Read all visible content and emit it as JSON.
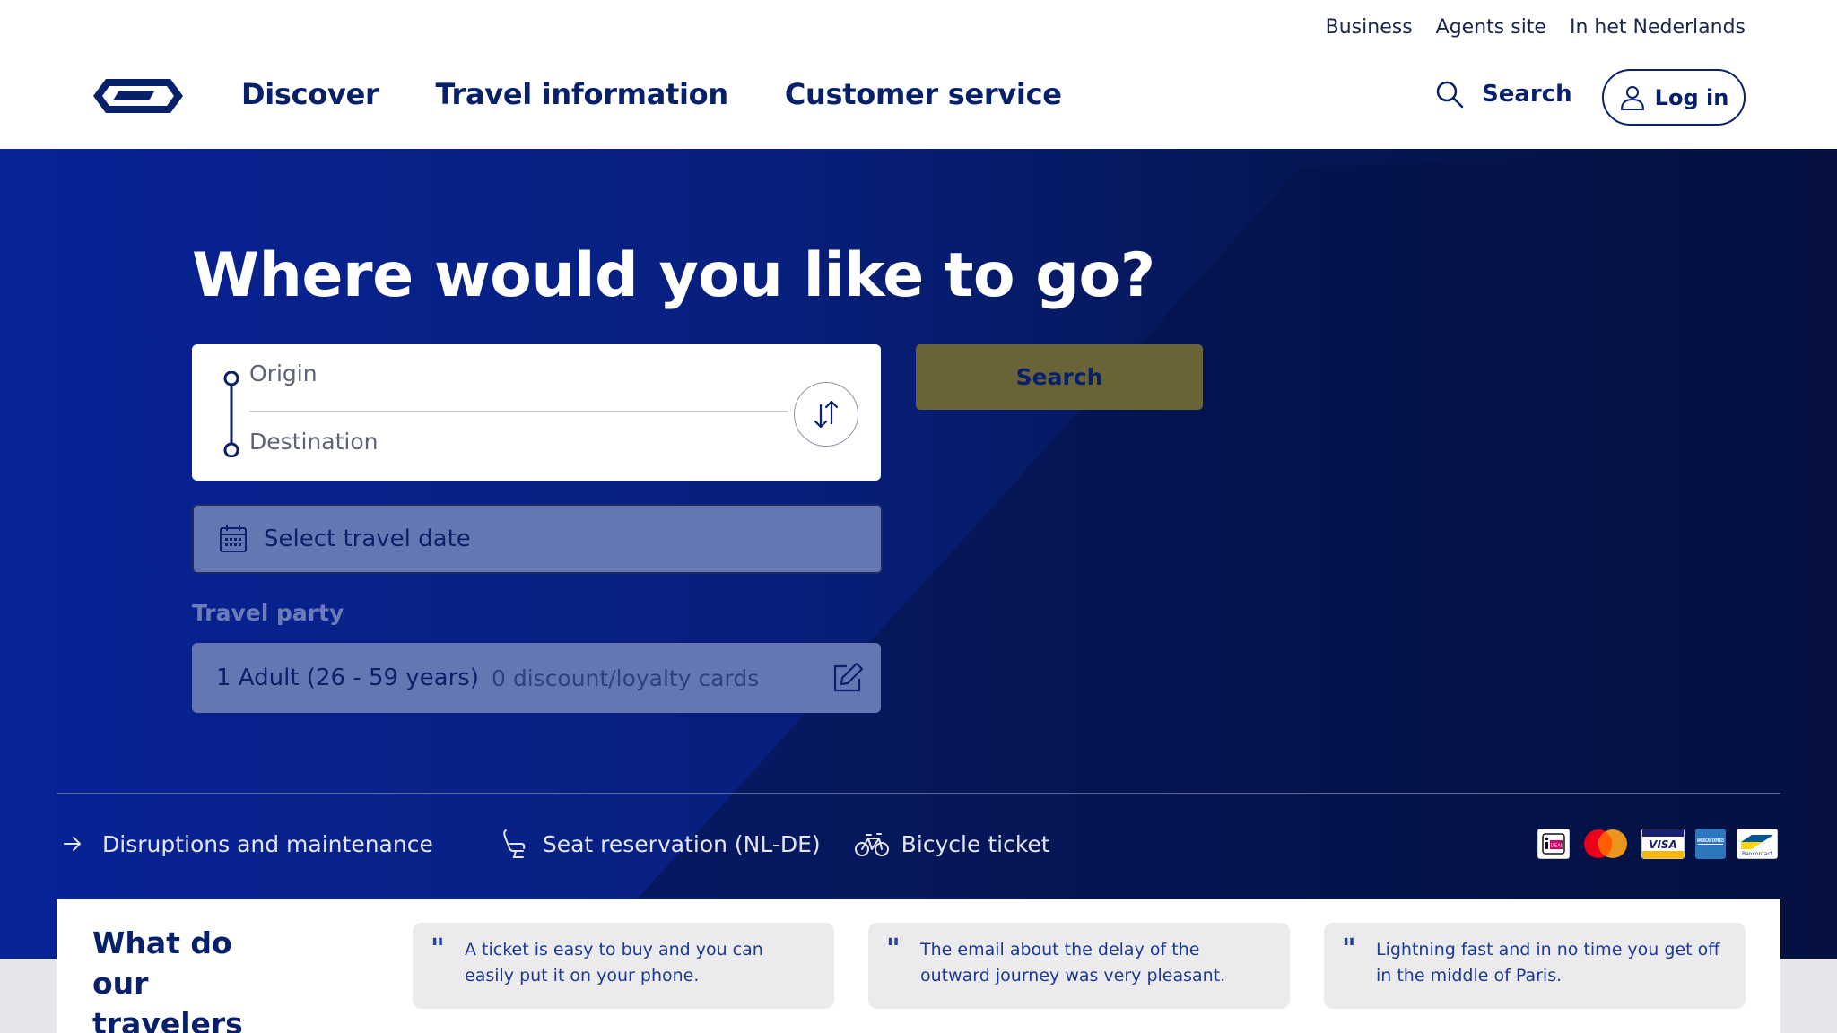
{
  "utility_nav": [
    "Business",
    "Agents site",
    "In het Nederlands"
  ],
  "main_nav": [
    "Discover",
    "Travel information",
    "Customer service"
  ],
  "header_search_label": "Search",
  "login_label": "Log in",
  "hero": {
    "title": "Where would you like to go?",
    "origin_placeholder": "Origin",
    "destination_placeholder": "Destination",
    "search_button": "Search",
    "date_label": "Select travel date",
    "travel_party_label": "Travel party",
    "travel_party_adult": "1 Adult (26 - 59 years)",
    "travel_party_cards": "0 discount/loyalty cards"
  },
  "quick_links": [
    "Disruptions and maintenance",
    "Seat reservation (NL-DE)",
    "Bicycle ticket"
  ],
  "payment_methods": [
    "ideal-icon",
    "mastercard-icon",
    "visa-icon",
    "amex-icon",
    "bancontact-icon"
  ],
  "payment_labels": {
    "ideal": "iDEAL",
    "visa": "VISA",
    "amex": "AMERICAN EXPRESS",
    "bancontact": "Bancontact"
  },
  "reviews": {
    "title": "What do our travelers say",
    "quotes": [
      "A ticket is easy to buy and you can easily put it on your phone.",
      "The email about the delay of the outward journey was very pleasant.",
      "Lightning fast and in no time you get off in the middle of Paris."
    ]
  },
  "colors": {
    "brand_blue": "#07206a",
    "hero_blue": "#072395",
    "search_button": "#6b6338",
    "white": "#ffffff"
  }
}
